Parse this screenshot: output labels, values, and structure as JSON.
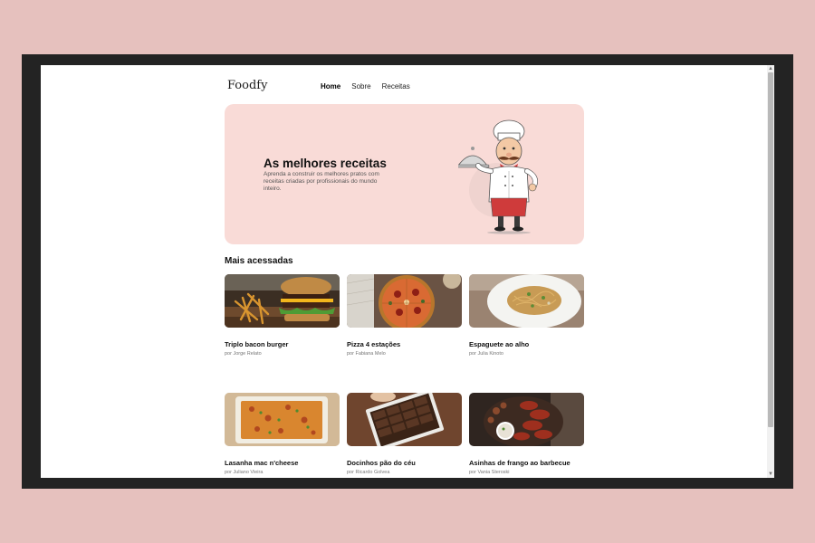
{
  "header": {
    "logo": "Foodfy",
    "nav": [
      {
        "label": "Home"
      },
      {
        "label": "Sobre"
      },
      {
        "label": "Receitas"
      }
    ]
  },
  "hero": {
    "title": "As melhores receitas",
    "description": "Aprenda a construir os melhores pratos com receitas criadas por profissionais do mundo inteiro."
  },
  "section": {
    "title": "Mais acessadas"
  },
  "recipes": [
    {
      "title": "Triplo bacon burger",
      "author": "por Jorge Relato",
      "image": "burger-photo"
    },
    {
      "title": "Pizza 4 estações",
      "author": "por Fabiana Melo",
      "image": "pizza-photo"
    },
    {
      "title": "Espaguete ao alho",
      "author": "por Julia Kinoto",
      "image": "spaghetti-photo"
    },
    {
      "title": "Lasanha mac n'cheese",
      "author": "por Juliano Vieira",
      "image": "lasagna-photo"
    },
    {
      "title": "Docinhos pão do céu",
      "author": "por Ricardo Golvea",
      "image": "sweets-photo"
    },
    {
      "title": "Asinhas de frango ao barbecue",
      "author": "por Vania Steroski",
      "image": "chicken-wings-photo"
    }
  ],
  "colors": {
    "background": "#e6c1be",
    "hero_bg": "#f9dbd7",
    "frame": "#232323",
    "chef_apron": "#cf3b3b"
  }
}
